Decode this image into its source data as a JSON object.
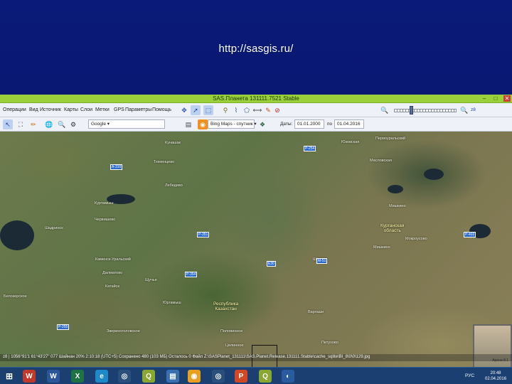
{
  "slide": {
    "url": "http://sasgis.ru/"
  },
  "window": {
    "title": "SAS.Планета 131111.7521 Stable"
  },
  "menu": [
    "Операции",
    "Вид",
    "Источник",
    "Карты",
    "Слои",
    "Метки",
    "GPS",
    "Параметры",
    "Помощь"
  ],
  "toolbar": {
    "search_engine": "Google",
    "map_source": "Bing Maps - спутник",
    "dates_label": "Даты:",
    "date_from": "01.01.2000",
    "date_to_label": "по",
    "date_to": "01.04.2016"
  },
  "map": {
    "labels": [
      "Кунашак",
      "Тюменцево",
      "Юзовская",
      "Масловская",
      "Лебедево",
      "Куртамыш",
      "Червишево",
      "Первоуральский",
      "Мишкино",
      "Шадринск",
      "Каменск-Уральский",
      "Далматово",
      "Катайск",
      "Щучье",
      "Шумиха",
      "Мишкино",
      "Мокроусово",
      "Варгаши",
      "Белозерское",
      "Юргамыш",
      "Половинное",
      "Звериноголовское",
      "Целинное",
      "Петухово"
    ],
    "region_kurgan": "Курганская\nобласть",
    "region_kazakhstan": "Республика\nКазахстан",
    "road_badges": [
      "P-254",
      "A-310",
      "P-351",
      "P-354",
      "E30",
      "M-51",
      "P-402",
      "P-255"
    ],
    "minimap_label": "Арена 8:1"
  },
  "status": {
    "text": "z8 | 1056°91'1 61°43'27\"  077 Шайнан  20%  2:10:18 (UTC+5)  Сохранено 480 (103 МБ)  Осталось 0  Файл Z:\\SASPlanet_131111\\SAS.Planet.Release.131111.Stable\\cache_sqlite\\BI_8\\0\\0\\129.jpg"
  },
  "taskbar": {
    "apps": [
      "start",
      "word-2010",
      "excel",
      "word",
      "ie",
      "sas-planet",
      "sas-planet-2",
      "chrome",
      "sas-planet-3",
      "powerpoint",
      "qgis",
      "network"
    ],
    "lang": "РУС",
    "time": "20:48",
    "date": "02.04.2016"
  },
  "colors": {
    "slide_bg": "#0a1a78",
    "titlebar": "#9ad03a",
    "taskbar": "#1a3f70"
  }
}
